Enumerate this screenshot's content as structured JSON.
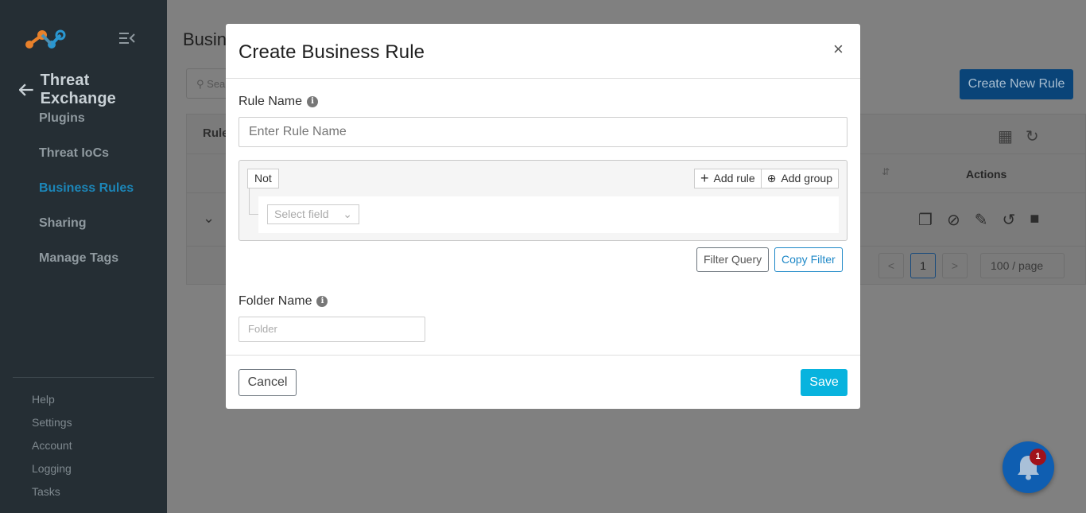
{
  "sidebar": {
    "back_title": "Threat Exchange",
    "nav": [
      {
        "label": "Plugins",
        "active": false
      },
      {
        "label": "Threat IoCs",
        "active": false
      },
      {
        "label": "Business Rules",
        "active": true
      },
      {
        "label": "Sharing",
        "active": false
      },
      {
        "label": "Manage Tags",
        "active": false
      }
    ],
    "bottom": [
      "Help",
      "Settings",
      "Account",
      "Logging",
      "Tasks"
    ]
  },
  "main": {
    "page_title": "Busin",
    "search_placeholder": "Sea",
    "create_button": "Create New Rule",
    "table_label": "Rule",
    "actions_header": "Actions",
    "pager": {
      "prev": "<",
      "current": "1",
      "next": ">",
      "page_size": "100 / page"
    }
  },
  "notifications": {
    "count": "1"
  },
  "modal": {
    "title": "Create Business Rule",
    "close": "×",
    "rule_name_label": "Rule Name",
    "rule_name_placeholder": "Enter Rule Name",
    "query": {
      "not_label": "Not",
      "add_rule": "Add rule",
      "add_group": "Add group",
      "select_field": "Select field"
    },
    "filter_query": "Filter Query",
    "copy_filter": "Copy Filter",
    "folder_label": "Folder Name",
    "folder_placeholder": "Folder",
    "cancel": "Cancel",
    "save": "Save"
  },
  "colors": {
    "accent": "#08b3de",
    "sidebar_bg": "#252e34",
    "active_nav": "#1c86b8",
    "badge": "#a0121b"
  }
}
